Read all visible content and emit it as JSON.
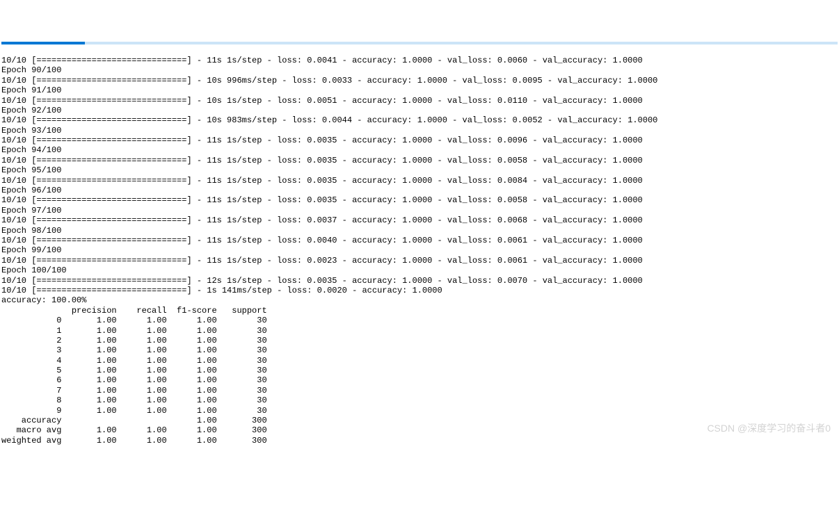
{
  "progress_bar": "10/10 [==============================]",
  "epochs": [
    {
      "pre": " - 11s 1s/step - loss: 0.0041 - accuracy: 1.0000 - val_loss: 0.0060 - val_accuracy: 1.0000",
      "label": "Epoch 90/100"
    },
    {
      "pre": " - 10s 996ms/step - loss: 0.0033 - accuracy: 1.0000 - val_loss: 0.0095 - val_accuracy: 1.0000",
      "label": "Epoch 91/100"
    },
    {
      "pre": " - 10s 1s/step - loss: 0.0051 - accuracy: 1.0000 - val_loss: 0.0110 - val_accuracy: 1.0000",
      "label": "Epoch 92/100"
    },
    {
      "pre": " - 10s 983ms/step - loss: 0.0044 - accuracy: 1.0000 - val_loss: 0.0052 - val_accuracy: 1.0000",
      "label": "Epoch 93/100"
    },
    {
      "pre": " - 11s 1s/step - loss: 0.0035 - accuracy: 1.0000 - val_loss: 0.0096 - val_accuracy: 1.0000",
      "label": "Epoch 94/100"
    },
    {
      "pre": " - 11s 1s/step - loss: 0.0035 - accuracy: 1.0000 - val_loss: 0.0058 - val_accuracy: 1.0000",
      "label": "Epoch 95/100"
    },
    {
      "pre": " - 11s 1s/step - loss: 0.0035 - accuracy: 1.0000 - val_loss: 0.0084 - val_accuracy: 1.0000",
      "label": "Epoch 96/100"
    },
    {
      "pre": " - 11s 1s/step - loss: 0.0035 - accuracy: 1.0000 - val_loss: 0.0058 - val_accuracy: 1.0000",
      "label": "Epoch 97/100"
    },
    {
      "pre": " - 11s 1s/step - loss: 0.0037 - accuracy: 1.0000 - val_loss: 0.0068 - val_accuracy: 1.0000",
      "label": "Epoch 98/100"
    },
    {
      "pre": " - 11s 1s/step - loss: 0.0040 - accuracy: 1.0000 - val_loss: 0.0061 - val_accuracy: 1.0000",
      "label": "Epoch 99/100"
    },
    {
      "pre": " - 11s 1s/step - loss: 0.0023 - accuracy: 1.0000 - val_loss: 0.0061 - val_accuracy: 1.0000",
      "label": "Epoch 100/100"
    },
    {
      "pre": " - 12s 1s/step - loss: 0.0035 - accuracy: 1.0000 - val_loss: 0.0070 - val_accuracy: 1.0000",
      "label": ""
    }
  ],
  "eval_line": " - 1s 141ms/step - loss: 0.0020 - accuracy: 1.0000",
  "accuracy_line": "accuracy: 100.00%",
  "report_header": "              precision    recall  f1-score   support",
  "report_rows": [
    "           0       1.00      1.00      1.00        30",
    "           1       1.00      1.00      1.00        30",
    "           2       1.00      1.00      1.00        30",
    "           3       1.00      1.00      1.00        30",
    "           4       1.00      1.00      1.00        30",
    "           5       1.00      1.00      1.00        30",
    "           6       1.00      1.00      1.00        30",
    "           7       1.00      1.00      1.00        30",
    "           8       1.00      1.00      1.00        30",
    "           9       1.00      1.00      1.00        30"
  ],
  "report_summary": [
    "    accuracy                           1.00       300",
    "   macro avg       1.00      1.00      1.00       300",
    "weighted avg       1.00      1.00      1.00       300"
  ],
  "watermark": "CSDN @深度学习的奋斗者0"
}
